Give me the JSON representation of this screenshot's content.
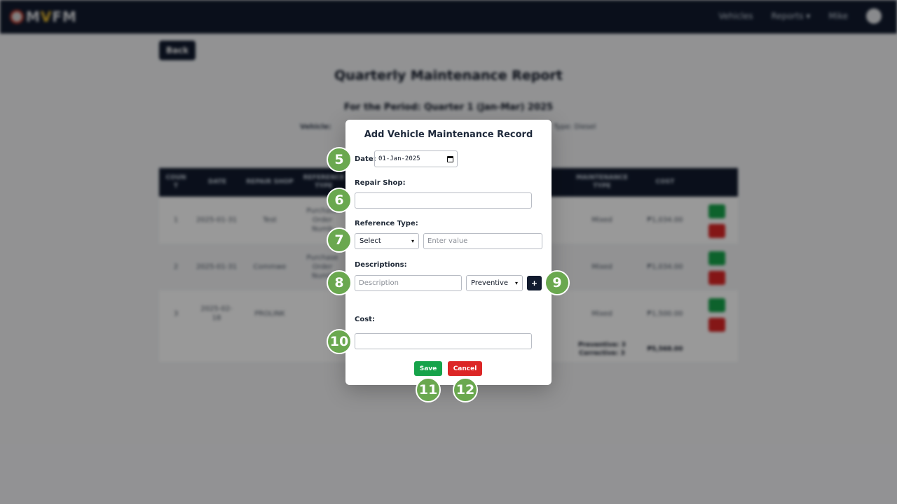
{
  "app": {
    "logo_text_pre": "M",
    "logo_text_v": "V",
    "logo_text_post": "FM",
    "nav": [
      "Vehicles",
      "Reports ▾",
      "Mike"
    ]
  },
  "report": {
    "back_label": "Back",
    "title": "Quarterly Maintenance Report",
    "period": "For the Period: Quarter 1 (Jan-Mar) 2025",
    "vehicle_label": "Vehicle:",
    "fuel_type": "Type: Diesel",
    "columns": [
      "COUN T",
      "DATE",
      "REPAIR SHOP",
      "REFERENCE TYPE",
      "MAINTENANCE TYPE",
      "COST"
    ],
    "rows": [
      {
        "count": "1",
        "date": "2025-01-31",
        "shop": "Test",
        "ref": "Purchase Order Numb",
        "mtype": "Mixed",
        "cost": "₱1,034.00"
      },
      {
        "count": "2",
        "date": "2025-01-31",
        "shop": "Commwe",
        "ref": "Purchase Order Numb",
        "mtype": "Mixed",
        "cost": "₱1,034.00"
      },
      {
        "count": "3",
        "date": "2025-02-18",
        "shop": "PROLINK",
        "ref": "",
        "mtype": "Mixed",
        "cost": "₱1,500.00"
      }
    ],
    "footer": {
      "preventive": "Preventive: 3",
      "corrective": "Corrective: 3",
      "total": "₱5,568.00"
    }
  },
  "modal": {
    "title": "Add Vehicle Maintenance Record",
    "date_label": "Date:",
    "date_value": "01-Jan-2025",
    "repair_shop_label": "Repair Shop:",
    "repair_shop_value": "",
    "reference_type_label": "Reference Type:",
    "reference_select": "Select",
    "reference_value_placeholder": "Enter value",
    "descriptions_label": "Descriptions:",
    "description_placeholder": "Description",
    "maintenance_type_select": "Preventive",
    "add_label": "+",
    "cost_label": "Cost:",
    "cost_value": "",
    "save_label": "Save",
    "cancel_label": "Cancel"
  },
  "markers": [
    "5",
    "6",
    "7",
    "8",
    "9",
    "10",
    "11",
    "12"
  ],
  "colors": {
    "navbar": "#111a2e",
    "save": "#16a34a",
    "cancel": "#dc2626",
    "marker": "#6aa84f"
  }
}
